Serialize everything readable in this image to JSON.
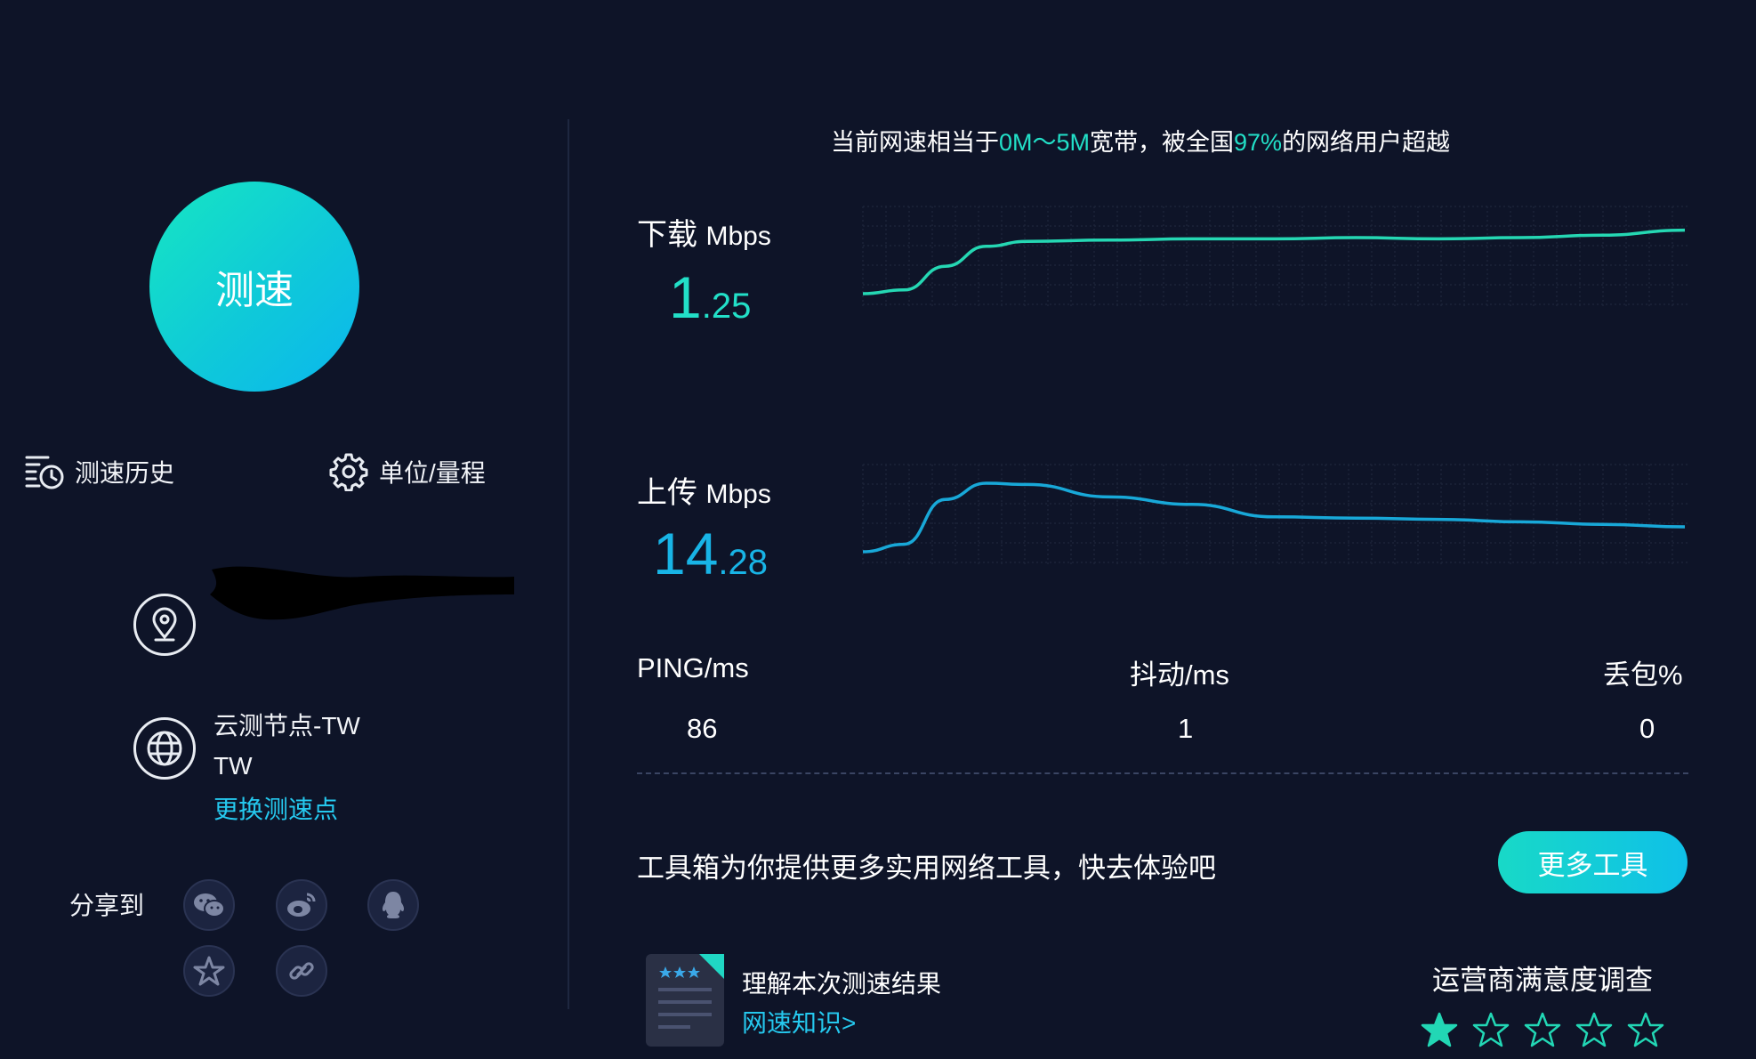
{
  "start_button": {
    "label": "测速"
  },
  "menu": {
    "history_label": "测速历史",
    "settings_label": "单位/量程"
  },
  "node": {
    "name": "云测节点-TW",
    "region": "TW",
    "change_label": "更换测速点"
  },
  "share": {
    "label": "分享到",
    "icons": [
      "wechat-icon",
      "weibo-icon",
      "qq-icon",
      "favorite-icon",
      "link-icon"
    ]
  },
  "summary": {
    "prefix": "当前网速相当于",
    "bandwidth": "0M～5M",
    "middle": "宽带，被全国",
    "percent": "97%",
    "suffix": "的网络用户超越"
  },
  "download": {
    "label": "下载",
    "unit": "Mbps",
    "value_int": "1",
    "value_dec": ".25"
  },
  "upload": {
    "label": "上传",
    "unit": "Mbps",
    "value_int": "14",
    "value_dec": ".28"
  },
  "chart_data": [
    {
      "type": "line",
      "name": "download",
      "color": "#25d7b3",
      "x": [
        0,
        0.05,
        0.1,
        0.15,
        0.2,
        0.3,
        0.4,
        0.5,
        0.6,
        0.7,
        0.8,
        0.9,
        1.0
      ],
      "values": [
        0.0,
        0.03,
        0.22,
        0.38,
        0.42,
        0.43,
        0.44,
        0.44,
        0.45,
        0.44,
        0.45,
        0.47,
        0.51
      ],
      "ylim": [
        0,
        1
      ]
    },
    {
      "type": "line",
      "name": "upload",
      "color": "#18a8d8",
      "x": [
        0,
        0.05,
        0.1,
        0.15,
        0.2,
        0.3,
        0.4,
        0.5,
        0.6,
        0.7,
        0.8,
        0.9,
        1.0
      ],
      "values": [
        0.0,
        0.06,
        0.42,
        0.55,
        0.54,
        0.44,
        0.38,
        0.28,
        0.27,
        0.26,
        0.24,
        0.22,
        0.2
      ],
      "ylim": [
        0,
        1
      ]
    }
  ],
  "stats": {
    "ping_label": "PING/ms",
    "ping_value": "86",
    "jitter_label": "抖动/ms",
    "jitter_value": "1",
    "loss_label": "丢包%",
    "loss_value": "0"
  },
  "tools": {
    "text": "工具箱为你提供更多实用网络工具，快去体验吧",
    "button": "更多工具"
  },
  "understand": {
    "title": "理解本次测速结果",
    "link": "网速知识>"
  },
  "survey": {
    "title": "运营商满意度调查",
    "rating": 1,
    "max": 5
  },
  "colors": {
    "background": "#0e1428",
    "accent": "#22e0c8",
    "link": "#25c8ee",
    "upload": "#18a8d8"
  }
}
